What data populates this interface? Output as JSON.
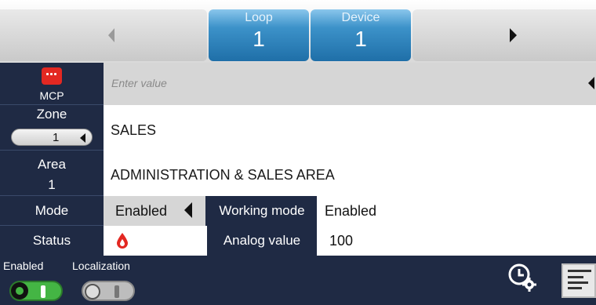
{
  "nav": {
    "tabs": [
      {
        "label": "Loop",
        "value": "1"
      },
      {
        "label": "Device",
        "value": "1"
      }
    ]
  },
  "device": {
    "type_label": "MCP",
    "input_placeholder": "Enter value"
  },
  "zone": {
    "label": "Zone",
    "value": "1",
    "name": "SALES"
  },
  "area": {
    "label": "Area",
    "value": "1",
    "name": "ADMINISTRATION & SALES AREA"
  },
  "mode": {
    "label": "Mode",
    "value": "Enabled",
    "working_label": "Working mode",
    "working_value": "Enabled"
  },
  "status": {
    "label": "Status",
    "analog_label": "Analog value",
    "analog_value": "100"
  },
  "footer": {
    "enabled_label": "Enabled",
    "enabled_state": true,
    "localization_label": "Localization",
    "localization_state": false
  },
  "colors": {
    "accent": "#2a82bf",
    "dark": "#1f2a44",
    "danger": "#e32822",
    "on": "#44b544"
  },
  "icons": [
    "mcp-icon",
    "status-drop-icon",
    "clock-settings-icon",
    "info-panel-icon"
  ]
}
